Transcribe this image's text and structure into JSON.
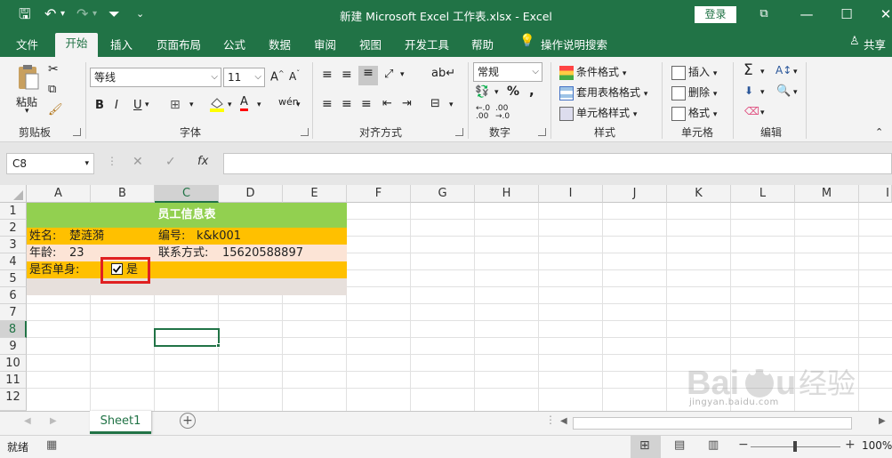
{
  "window": {
    "title": "新建 Microsoft Excel 工作表.xlsx  -  Excel",
    "login_label": "登录",
    "share_label": "共享"
  },
  "tabs": [
    "文件",
    "开始",
    "插入",
    "页面布局",
    "公式",
    "数据",
    "审阅",
    "视图",
    "开发工具",
    "帮助",
    "操作说明搜索"
  ],
  "ribbon": {
    "clipboard": {
      "paste": "粘贴",
      "group": "剪贴板"
    },
    "font": {
      "name": "等线",
      "size": "11",
      "group": "字体",
      "bold": "B",
      "italic": "I",
      "underline": "U"
    },
    "alignment": {
      "group": "对齐方式"
    },
    "number": {
      "format": "常规",
      "percent": "%",
      "comma": ",",
      "group": "数字"
    },
    "styles": {
      "conditional": "条件格式",
      "table": "套用表格格式",
      "cell": "单元格样式",
      "group": "样式"
    },
    "cells": {
      "insert": "插入",
      "delete": "删除",
      "format": "格式",
      "group": "单元格"
    },
    "editing": {
      "group": "编辑"
    }
  },
  "formula_bar": {
    "name_box": "C8",
    "fx": "fx",
    "value": ""
  },
  "columns": [
    "A",
    "B",
    "C",
    "D",
    "E",
    "F",
    "G",
    "H",
    "I",
    "J",
    "K",
    "L",
    "M",
    "I"
  ],
  "rows": [
    "1",
    "2",
    "3",
    "4",
    "5",
    "6",
    "7",
    "8",
    "9",
    "10",
    "11",
    "12"
  ],
  "sheet": {
    "title": "员工信息表",
    "name_label": "姓名:",
    "name_value": "楚涟漪",
    "id_label": "编号:",
    "id_value": "k&k001",
    "age_label": "年龄:",
    "age_value": "23",
    "contact_label": "联系方式:",
    "contact_value": "15620588897",
    "single_label": "是否单身:",
    "checkbox_label": "是",
    "checkbox_checked": true
  },
  "sheet_tabs": [
    "Sheet1"
  ],
  "status": {
    "ready": "就绪",
    "zoom": "100%"
  },
  "colors": {
    "excel_green": "#217346",
    "title_fill": "#92d050",
    "orange_fill": "#ffc000",
    "light_fill": "#fce4d6",
    "grey_fill": "#e7e0dc",
    "highlight": "#e02020"
  },
  "watermark": "Baidu 经验 jingyan.baidu.com"
}
